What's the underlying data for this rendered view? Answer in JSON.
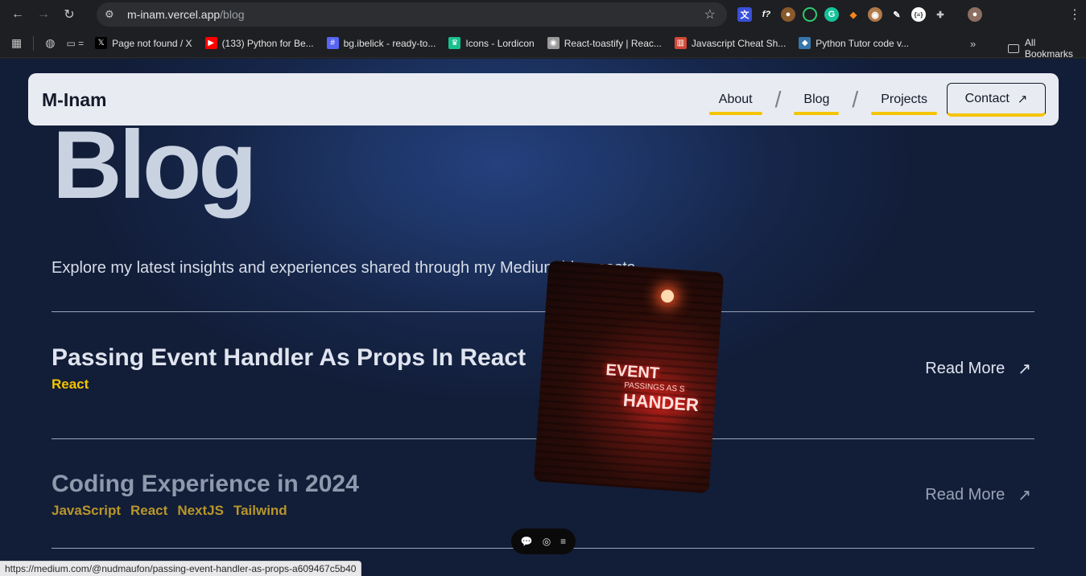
{
  "browser": {
    "url_host": "m-inam.vercel.app",
    "url_path": "/blog",
    "bookmarks": [
      {
        "label": "Page not found / X",
        "icon": "x-icon",
        "color": "#000000",
        "glyph": "𝕏"
      },
      {
        "label": "(133) Python for Be...",
        "icon": "youtube-icon",
        "color": "#ff0000",
        "glyph": "▶"
      },
      {
        "label": "bg.ibelick - ready-to...",
        "icon": "hash-icon",
        "color": "#5865f2",
        "glyph": "#"
      },
      {
        "label": "Icons - Lordicon",
        "icon": "lordicon-icon",
        "color": "#18c08f",
        "glyph": "♛"
      },
      {
        "label": "React-toastify | Reac...",
        "icon": "toastify-icon",
        "color": "#9a9a9a",
        "glyph": "◉"
      },
      {
        "label": "Javascript Cheat Sh...",
        "icon": "cheatsheet-icon",
        "color": "#d14836",
        "glyph": "▥"
      },
      {
        "label": "Python Tutor code v...",
        "icon": "python-icon",
        "color": "#3776ab",
        "glyph": "◆"
      }
    ],
    "all_bookmarks_label": "All Bookmarks",
    "status_url": "https://medium.com/@nudmaufon/passing-event-handler-as-props-a609467c5b40"
  },
  "site": {
    "logo": "M-Inam",
    "nav": {
      "about": "About",
      "blog": "Blog",
      "projects": "Projects",
      "contact": "Contact"
    },
    "accent_color": "#f5c400"
  },
  "hero": {
    "title": "Blog",
    "intro": "Explore my latest insights and experiences shared through my Medium blog posts."
  },
  "posts": [
    {
      "title": "Passing Event Handler As Props In React",
      "tags": [
        "React"
      ],
      "link_label": "Read More"
    },
    {
      "title": "Coding Experience in 2024",
      "tags": [
        "JavaScript",
        "React",
        "NextJS",
        "Tailwind"
      ],
      "link_label": "Read More"
    }
  ],
  "thumbnail": {
    "line1": "EVENT",
    "line2": "PASSINGS AS S",
    "line3": "HANDER"
  }
}
